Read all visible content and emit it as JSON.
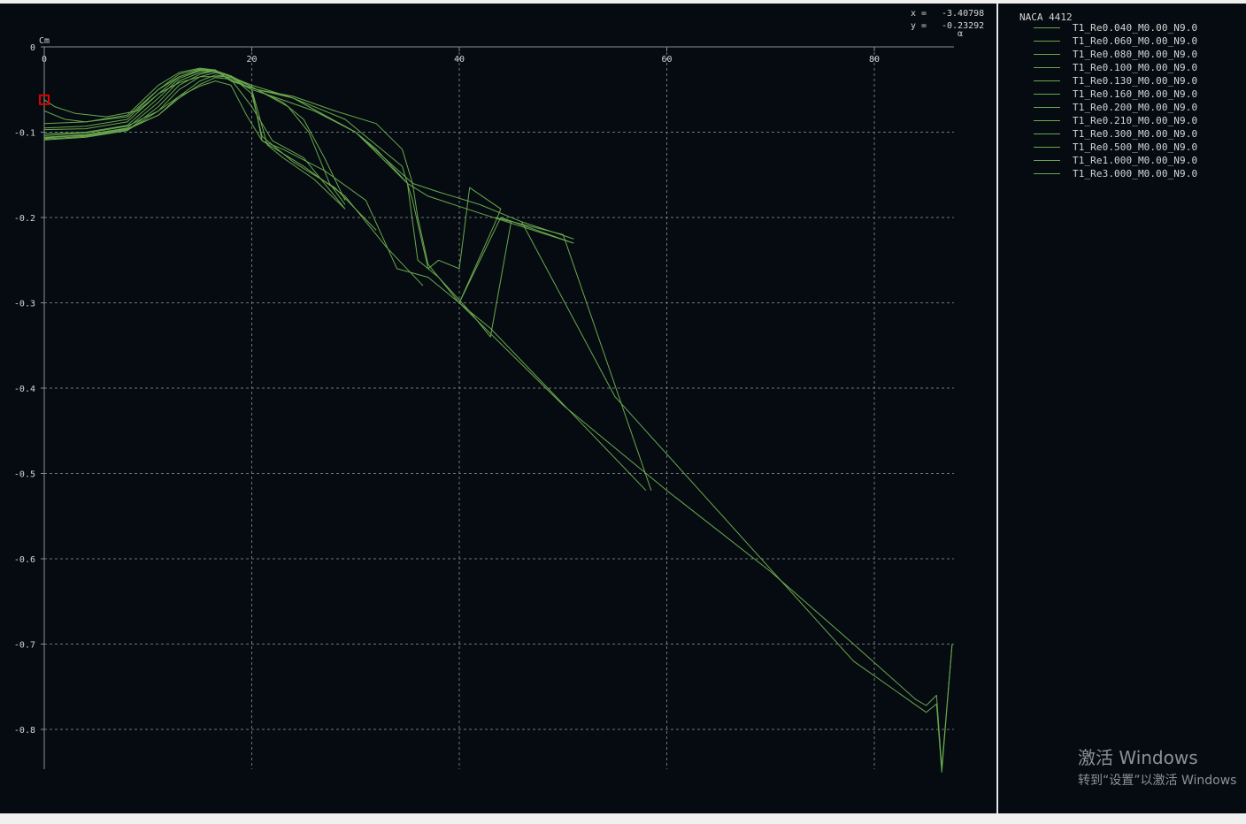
{
  "plot": {
    "readout": {
      "x_label": "x =",
      "x_value": "-3.40798",
      "y_label": "y =",
      "y_value": "-0.23292"
    }
  },
  "legend": {
    "title": "NACA 4412",
    "entries": [
      "T1_Re0.040_M0.00_N9.0",
      "T1_Re0.060_M0.00_N9.0",
      "T1_Re0.080_M0.00_N9.0",
      "T1_Re0.100_M0.00_N9.0",
      "T1_Re0.130_M0.00_N9.0",
      "T1_Re0.160_M0.00_N9.0",
      "T1_Re0.200_M0.00_N9.0",
      "T1_Re0.210_M0.00_N9.0",
      "T1_Re0.300_M0.00_N9.0",
      "T1_Re0.500_M0.00_N9.0",
      "T1_Re1.000_M0.00_N9.0",
      "T1_Re3.000_M0.00_N9.0"
    ]
  },
  "watermark": {
    "line1": "激活 Windows",
    "line2": "转到“设置”以激活 Windows"
  },
  "chart_data": {
    "type": "line",
    "title": "NACA 4412",
    "xlabel": "α",
    "ylabel": "Cm",
    "xlim": [
      0,
      88
    ],
    "ylim": [
      -0.85,
      0
    ],
    "x_ticks": [
      0,
      20,
      40,
      60,
      80
    ],
    "y_ticks": [
      0,
      -0.1,
      -0.2,
      -0.3,
      -0.4,
      -0.5,
      -0.6,
      -0.7,
      -0.8
    ],
    "y_tick_labels": [
      "0",
      "-0.1",
      "-0.2",
      "-0.3",
      "-0.4",
      "-0.5",
      "-0.6",
      "-0.7",
      "-0.8"
    ],
    "grid": true,
    "line_color": "#6aa84f",
    "marker": {
      "x": 0,
      "y": -0.062,
      "color": "#e00000"
    },
    "series": [
      {
        "name": "T1_Re0.040_M0.00_N9.0",
        "points": [
          [
            0,
            -0.104
          ],
          [
            4,
            -0.101
          ],
          [
            8,
            -0.093
          ],
          [
            11,
            -0.075
          ],
          [
            13,
            -0.058
          ],
          [
            15,
            -0.046
          ],
          [
            16.5,
            -0.04
          ],
          [
            18,
            -0.045
          ],
          [
            19.5,
            -0.08
          ],
          [
            21,
            -0.11
          ],
          [
            23,
            -0.12
          ],
          [
            27,
            -0.145
          ],
          [
            31,
            -0.18
          ],
          [
            34,
            -0.26
          ],
          [
            37,
            -0.27
          ],
          [
            40,
            -0.3
          ],
          [
            43,
            -0.33
          ],
          [
            58,
            -0.52
          ]
        ]
      },
      {
        "name": "T1_Re0.060_M0.00_N9.0",
        "points": [
          [
            0,
            -0.107
          ],
          [
            4,
            -0.103
          ],
          [
            8,
            -0.096
          ],
          [
            11,
            -0.08
          ],
          [
            13,
            -0.06
          ],
          [
            15,
            -0.044
          ],
          [
            16.5,
            -0.036
          ],
          [
            18,
            -0.038
          ],
          [
            20,
            -0.07
          ],
          [
            22,
            -0.11
          ],
          [
            25,
            -0.13
          ],
          [
            27,
            -0.16
          ],
          [
            29,
            -0.19
          ]
        ]
      },
      {
        "name": "T1_Re0.080_M0.00_N9.0",
        "points": [
          [
            0,
            -0.106
          ],
          [
            4,
            -0.104
          ],
          [
            8,
            -0.097
          ],
          [
            11,
            -0.08
          ],
          [
            13,
            -0.058
          ],
          [
            15,
            -0.04
          ],
          [
            16.5,
            -0.033
          ],
          [
            18,
            -0.036
          ],
          [
            20,
            -0.05
          ],
          [
            21.5,
            -0.115
          ],
          [
            23,
            -0.13
          ],
          [
            26,
            -0.155
          ],
          [
            29,
            -0.19
          ]
        ]
      },
      {
        "name": "T1_Re0.100_M0.00_N9.0",
        "points": [
          [
            0,
            -0.108
          ],
          [
            4,
            -0.105
          ],
          [
            8,
            -0.098
          ],
          [
            11,
            -0.075
          ],
          [
            13,
            -0.05
          ],
          [
            15,
            -0.035
          ],
          [
            16.5,
            -0.03
          ],
          [
            18,
            -0.035
          ],
          [
            20.5,
            -0.05
          ],
          [
            23.5,
            -0.07
          ],
          [
            25.5,
            -0.1
          ],
          [
            27.5,
            -0.16
          ],
          [
            29,
            -0.185
          ]
        ]
      },
      {
        "name": "T1_Re0.130_M0.00_N9.0",
        "points": [
          [
            0,
            -0.109
          ],
          [
            4,
            -0.106
          ],
          [
            8,
            -0.098
          ],
          [
            11,
            -0.07
          ],
          [
            13,
            -0.045
          ],
          [
            15,
            -0.032
          ],
          [
            16.5,
            -0.028
          ],
          [
            18,
            -0.034
          ],
          [
            20.5,
            -0.05
          ],
          [
            23,
            -0.065
          ],
          [
            25,
            -0.085
          ],
          [
            27,
            -0.13
          ],
          [
            29,
            -0.18
          ]
        ]
      },
      {
        "name": "T1_Re0.160_M0.00_N9.0",
        "points": [
          [
            0,
            -0.106
          ],
          [
            4,
            -0.103
          ],
          [
            8,
            -0.095
          ],
          [
            11,
            -0.065
          ],
          [
            13,
            -0.04
          ],
          [
            15,
            -0.03
          ],
          [
            16.5,
            -0.028
          ],
          [
            18,
            -0.034
          ],
          [
            20,
            -0.055
          ],
          [
            21,
            -0.105
          ],
          [
            24,
            -0.135
          ],
          [
            28,
            -0.165
          ],
          [
            32,
            -0.215
          ]
        ]
      },
      {
        "name": "T1_Re0.200_M0.00_N9.0",
        "points": [
          [
            0,
            -0.102
          ],
          [
            4,
            -0.1
          ],
          [
            8,
            -0.092
          ],
          [
            11,
            -0.06
          ],
          [
            13,
            -0.037
          ],
          [
            15,
            -0.028
          ],
          [
            16.5,
            -0.028
          ],
          [
            18,
            -0.035
          ],
          [
            20,
            -0.05
          ],
          [
            21,
            -0.11
          ],
          [
            25,
            -0.14
          ],
          [
            29,
            -0.175
          ],
          [
            33,
            -0.235
          ],
          [
            36.5,
            -0.28
          ]
        ]
      },
      {
        "name": "T1_Re0.210_M0.00_N9.0",
        "points": [
          [
            0,
            -0.097
          ],
          [
            4,
            -0.096
          ],
          [
            8,
            -0.088
          ],
          [
            11,
            -0.055
          ],
          [
            13,
            -0.035
          ],
          [
            15,
            -0.027
          ],
          [
            16.5,
            -0.028
          ],
          [
            18,
            -0.04
          ],
          [
            20.5,
            -0.05
          ],
          [
            24,
            -0.058
          ],
          [
            28,
            -0.075
          ],
          [
            32,
            -0.09
          ],
          [
            34.5,
            -0.12
          ],
          [
            35.5,
            -0.16
          ],
          [
            36,
            -0.2
          ],
          [
            37,
            -0.255
          ],
          [
            40,
            -0.3
          ]
        ]
      },
      {
        "name": "T1_Re0.300_M0.00_N9.0",
        "points": [
          [
            0,
            -0.095
          ],
          [
            4,
            -0.093
          ],
          [
            8,
            -0.085
          ],
          [
            11,
            -0.05
          ],
          [
            13,
            -0.032
          ],
          [
            15,
            -0.026
          ],
          [
            16.5,
            -0.027
          ],
          [
            18,
            -0.04
          ],
          [
            20.5,
            -0.05
          ],
          [
            24,
            -0.06
          ],
          [
            29,
            -0.085
          ],
          [
            34.5,
            -0.14
          ],
          [
            35.5,
            -0.18
          ],
          [
            37,
            -0.26
          ],
          [
            38,
            -0.25
          ],
          [
            40,
            -0.26
          ],
          [
            41,
            -0.165
          ],
          [
            44,
            -0.19
          ],
          [
            43.5,
            -0.205
          ],
          [
            40,
            -0.3
          ]
        ]
      },
      {
        "name": "T1_Re0.500_M0.00_N9.0",
        "points": [
          [
            0,
            -0.09
          ],
          [
            4,
            -0.088
          ],
          [
            8,
            -0.08
          ],
          [
            11,
            -0.045
          ],
          [
            13,
            -0.03
          ],
          [
            15,
            -0.025
          ],
          [
            16.5,
            -0.027
          ],
          [
            18,
            -0.04
          ],
          [
            20.5,
            -0.05
          ],
          [
            24,
            -0.06
          ],
          [
            30,
            -0.1
          ],
          [
            35,
            -0.16
          ],
          [
            36,
            -0.25
          ],
          [
            38,
            -0.27
          ],
          [
            41,
            -0.31
          ],
          [
            43,
            -0.34
          ],
          [
            45,
            -0.205
          ],
          [
            43.5,
            -0.2
          ],
          [
            50,
            -0.22
          ],
          [
            58.5,
            -0.52
          ]
        ]
      },
      {
        "name": "T1_Re1.000_M0.00_N9.0",
        "points": [
          [
            0,
            -0.075
          ],
          [
            2,
            -0.085
          ],
          [
            4,
            -0.088
          ],
          [
            8,
            -0.082
          ],
          [
            11,
            -0.05
          ],
          [
            13,
            -0.035
          ],
          [
            15,
            -0.027
          ],
          [
            17,
            -0.03
          ],
          [
            20,
            -0.045
          ],
          [
            24,
            -0.06
          ],
          [
            30,
            -0.1
          ],
          [
            35.5,
            -0.16
          ],
          [
            38,
            -0.17
          ],
          [
            42,
            -0.185
          ],
          [
            46,
            -0.205
          ],
          [
            51,
            -0.225
          ],
          [
            46,
            -0.205
          ],
          [
            55,
            -0.41
          ],
          [
            78,
            -0.72
          ],
          [
            85,
            -0.78
          ],
          [
            86,
            -0.77
          ],
          [
            86.5,
            -0.85
          ],
          [
            87.5,
            -0.7
          ]
        ]
      },
      {
        "name": "T1_Re3.000_M0.00_N9.0",
        "points": [
          [
            0,
            -0.062
          ],
          [
            1,
            -0.07
          ],
          [
            3,
            -0.078
          ],
          [
            6,
            -0.082
          ],
          [
            9,
            -0.075
          ],
          [
            11,
            -0.055
          ],
          [
            13,
            -0.042
          ],
          [
            15,
            -0.035
          ],
          [
            17.5,
            -0.035
          ],
          [
            20,
            -0.05
          ],
          [
            22,
            -0.058
          ],
          [
            26,
            -0.075
          ],
          [
            30,
            -0.1
          ],
          [
            32,
            -0.12
          ],
          [
            35,
            -0.16
          ],
          [
            37,
            -0.175
          ],
          [
            42,
            -0.195
          ],
          [
            51,
            -0.23
          ],
          [
            44,
            -0.2
          ],
          [
            40,
            -0.3
          ],
          [
            50,
            -0.42
          ],
          [
            60,
            -0.52
          ],
          [
            70,
            -0.615
          ],
          [
            78,
            -0.7
          ],
          [
            84,
            -0.765
          ],
          [
            85,
            -0.772
          ],
          [
            86,
            -0.76
          ],
          [
            86.5,
            -0.845
          ],
          [
            87.5,
            -0.7
          ]
        ]
      }
    ]
  }
}
